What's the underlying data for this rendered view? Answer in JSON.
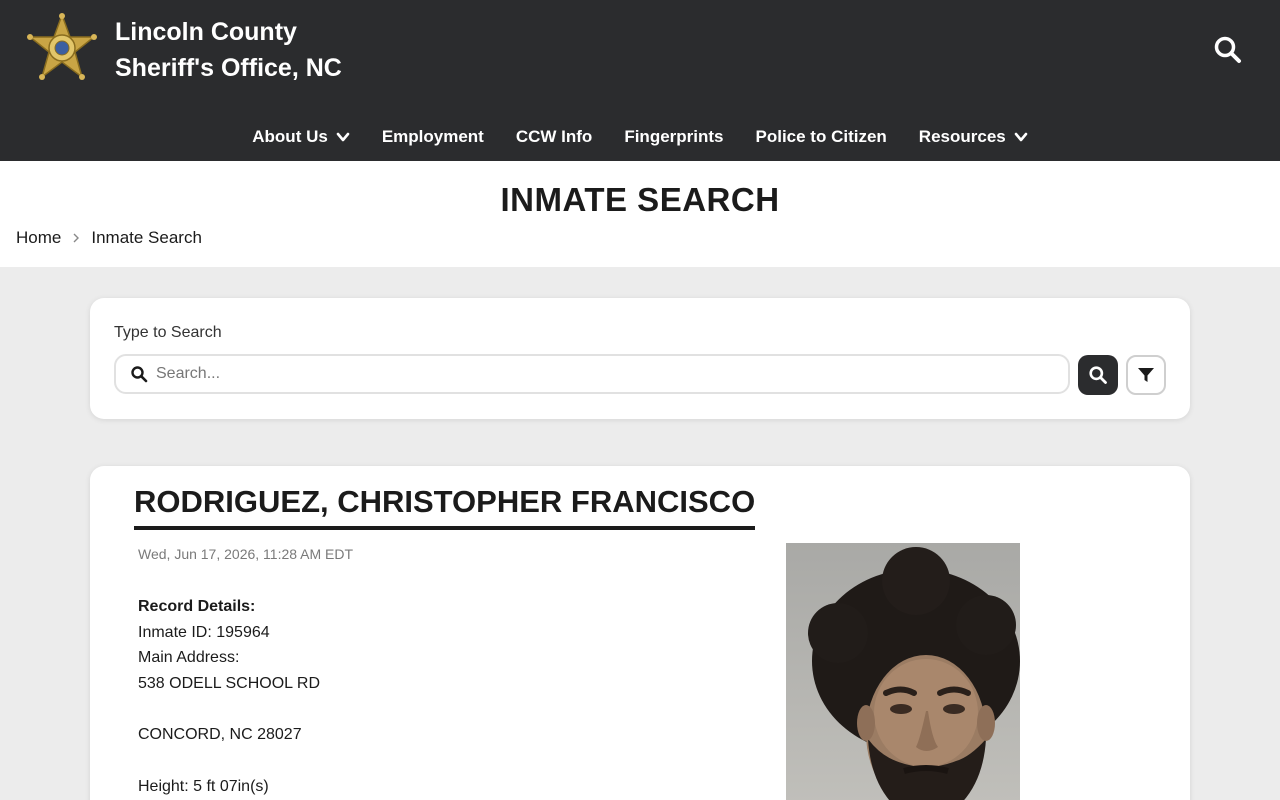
{
  "header": {
    "brand_line1": "Lincoln County",
    "brand_line2": "Sheriff's Office, NC",
    "logo_icon": "sheriff-star-badge",
    "search_icon": "search-icon"
  },
  "nav": {
    "items": [
      {
        "label": "About Us",
        "dropdown": true
      },
      {
        "label": "Employment",
        "dropdown": false
      },
      {
        "label": "CCW Info",
        "dropdown": false
      },
      {
        "label": "Fingerprints",
        "dropdown": false
      },
      {
        "label": "Police to Citizen",
        "dropdown": false
      },
      {
        "label": "Resources",
        "dropdown": true
      }
    ]
  },
  "page": {
    "title": "INMATE SEARCH",
    "breadcrumb": [
      "Home",
      "Inmate Search"
    ]
  },
  "search": {
    "label": "Type to Search",
    "placeholder": "Search...",
    "value": ""
  },
  "inmate": {
    "name": "RODRIGUEZ, CHRISTOPHER FRANCISCO",
    "timestamp": "Wed, Jun 17, 2026, 11:28 AM EDT",
    "details_heading": "Record Details:",
    "inmate_id": "Inmate ID: 195964",
    "address_label": "Main Address:",
    "address_line1": "538 ODELL SCHOOL RD",
    "address_line2": "CONCORD, NC 28027",
    "height": "Height: 5 ft 07in(s)"
  },
  "colors": {
    "header_bg": "#2b2c2e",
    "page_bg": "#ececec",
    "card_bg": "#ffffff",
    "text": "#1b1b1b",
    "badge_gold": "#c9a545"
  }
}
